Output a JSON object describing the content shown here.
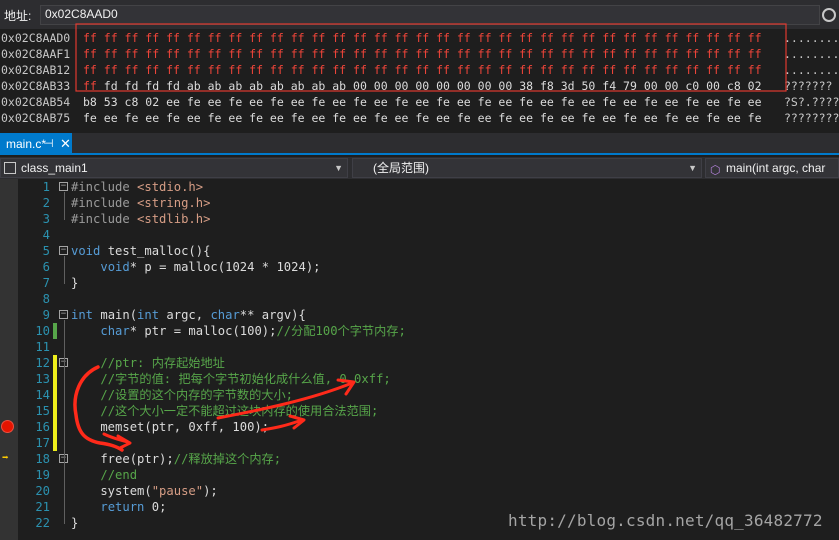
{
  "address_bar": {
    "label": "地址:",
    "value": "0x02C8AAD0"
  },
  "memory": {
    "rows": [
      {
        "address": "0x02C8AAD0",
        "bytes": "ff ff ff ff ff ff ff ff ff ff ff ff ff ff ff ff ff ff ff ff ff ff ff ff ff ff ff ff ff ff ff ff ff",
        "ascii": "........."
      },
      {
        "address": "0x02C8AAF1",
        "bytes": "ff ff ff ff ff ff ff ff ff ff ff ff ff ff ff ff ff ff ff ff ff ff ff ff ff ff ff ff ff ff ff ff ff",
        "ascii": "........."
      },
      {
        "address": "0x02C8AB12",
        "bytes": "ff ff ff ff ff ff ff ff ff ff ff ff ff ff ff ff ff ff ff ff ff ff ff ff ff ff ff ff ff ff ff ff ff",
        "ascii": "........."
      },
      {
        "address": "0x02C8AB33",
        "bytes_red": "ff",
        "bytes": " fd fd fd fd ab ab ab ab ab ab ab ab 00 00 00 00 00 00 00 00 38 f8 3d 50 f4 79 00 00 c0 00 c8 02",
        "ascii": "???????"
      },
      {
        "address": "0x02C8AB54",
        "bytes": "b8 53 c8 02 ee fe ee fe ee fe ee fe ee fe ee fe ee fe ee fe ee fe ee fe ee fe ee fe ee fe ee fe ee",
        "ascii": "?S?.????"
      },
      {
        "address": "0x02C8AB75",
        "bytes": "fe ee fe ee fe ee fe ee fe ee fe ee fe ee fe ee fe ee fe ee fe ee fe ee fe ee fe ee fe ee fe ee fe",
        "ascii": "????????"
      }
    ]
  },
  "tabs": [
    {
      "label": "main.c*",
      "pin": "⊣",
      "close": "✕"
    }
  ],
  "navbar": {
    "project": "class_main1",
    "scope": "(全局范围)",
    "function": "main(int argc, char"
  },
  "code": {
    "lines": [
      {
        "num": "1",
        "html": "<span class=\"pp\">#include</span> <span class=\"s\">&lt;stdio.h&gt;</span>"
      },
      {
        "num": "2",
        "html": "<span class=\"pp\">#include</span> <span class=\"s\">&lt;string.h&gt;</span>"
      },
      {
        "num": "3",
        "html": "<span class=\"pp\">#include</span> <span class=\"s\">&lt;stdlib.h&gt;</span>"
      },
      {
        "num": "4",
        "html": ""
      },
      {
        "num": "5",
        "html": "<span class=\"k\">void</span> test_malloc(){"
      },
      {
        "num": "6",
        "html": "    <span class=\"k\">void</span>* p = malloc(1024 * 1024);"
      },
      {
        "num": "7",
        "html": "}"
      },
      {
        "num": "8",
        "html": ""
      },
      {
        "num": "9",
        "html": "<span class=\"k\">int</span> main(<span class=\"k\">int</span> argc, <span class=\"k\">char</span>** argv){"
      },
      {
        "num": "10",
        "html": "    <span class=\"k\">char</span>* ptr = malloc(100);<span class=\"c\">//分配100个字节内存;</span>"
      },
      {
        "num": "11",
        "html": ""
      },
      {
        "num": "12",
        "html": "    <span class=\"c\">//ptr: 内存起始地址</span>"
      },
      {
        "num": "13",
        "html": "    <span class=\"c\">//字节的值: 把每个字节初始化成什么值, 0,0xff;</span>"
      },
      {
        "num": "14",
        "html": "    <span class=\"c\">//设置的这个内存的字节数的大小;</span>"
      },
      {
        "num": "15",
        "html": "    <span class=\"c\">//这个大小一定不能超过这块内存的使用合法范围;</span>"
      },
      {
        "num": "16",
        "html": "    memset(ptr, 0xff, 100);"
      },
      {
        "num": "17",
        "html": ""
      },
      {
        "num": "18",
        "html": "    free(ptr);<span class=\"c\">//释放掉这个内存;</span>"
      },
      {
        "num": "19",
        "html": "    <span class=\"c\">//end</span>"
      },
      {
        "num": "20",
        "html": "    system(<span class=\"s\">\"pause\"</span>);"
      },
      {
        "num": "21",
        "html": "    <span class=\"k\">return</span> 0;"
      },
      {
        "num": "22",
        "html": "}"
      }
    ]
  },
  "watermark": "http://blog.csdn.net/qq_36482772",
  "colors": {
    "accent": "#007acc",
    "breakpoint": "#e51400",
    "annotation": "#ff2a1a"
  }
}
